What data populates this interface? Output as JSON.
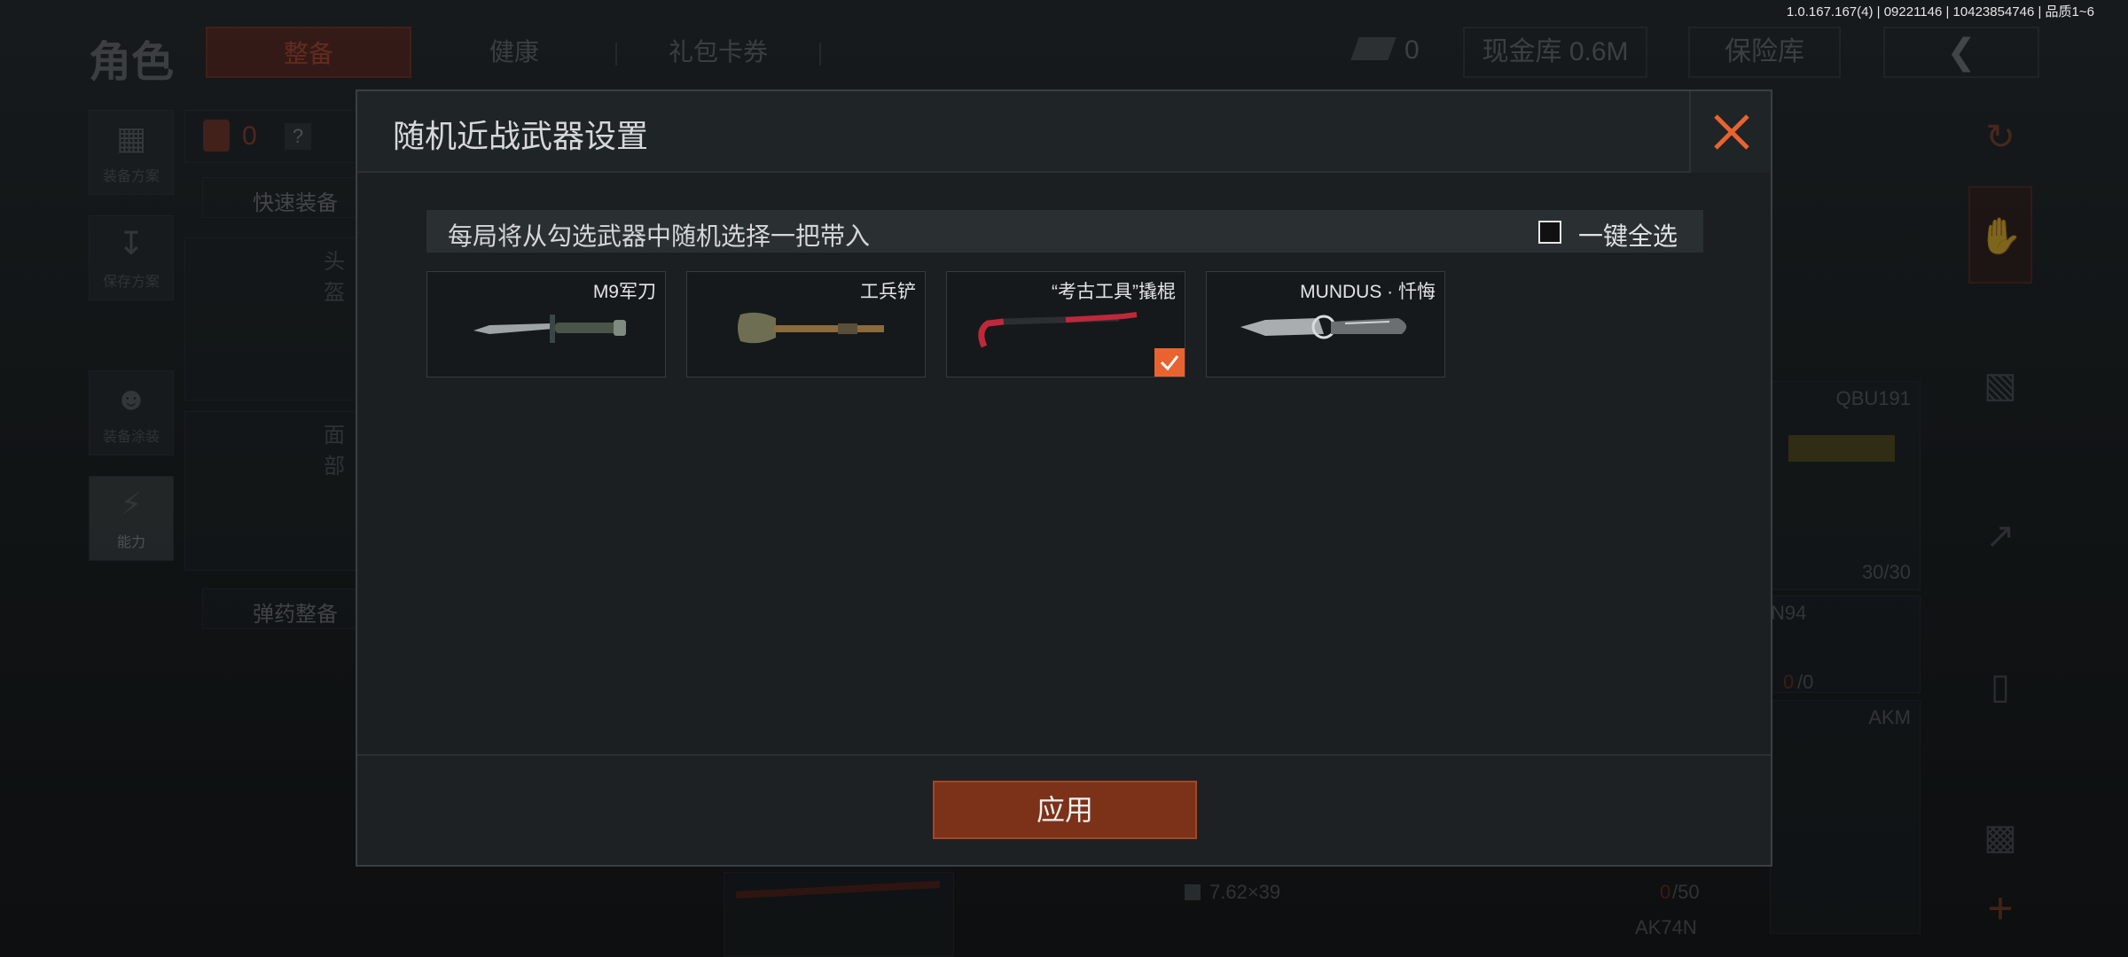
{
  "version": "1.0.167.167(4) | 09221146 | 10423854746 | 品质1~6",
  "topbar": {
    "title": "角色",
    "tabs": [
      "整备",
      "健康",
      "礼包卡券"
    ],
    "currency_value": "0",
    "cash_vault": "现金库 0.6M",
    "insurance_vault": "保险库"
  },
  "left_nav": [
    {
      "label": "装备方案",
      "icon": "vest-icon"
    },
    {
      "label": "保存方案",
      "icon": "download-icon"
    },
    {
      "label": "装备涂装",
      "icon": "soldier-icon"
    },
    {
      "label": "能力",
      "icon": "lightning-icon"
    }
  ],
  "background": {
    "armor_count": "0",
    "quick_equip": "快速装备",
    "head_slot": "头盔",
    "face_slot": "面部",
    "ammo_equip": "弹药整备",
    "weapon_qbu": "QBU191",
    "ammo_qbu": "30/30",
    "weapon_n94": "N94",
    "ammo_n94_cur": "0",
    "ammo_n94_max": "/0",
    "weapon_akm": "AKM",
    "caliber": "7.62×39",
    "ammo_akm_cur": "0",
    "ammo_akm_max": "/50",
    "weapon_ak74n": "AK74N"
  },
  "modal": {
    "title": "随机近战武器设置",
    "info": "每局将从勾选武器中随机选择一把带入",
    "select_all_label": "一键全选",
    "select_all_checked": false,
    "weapons": [
      {
        "name": "M9军刀",
        "icon": "combat-knife-icon",
        "checked": false
      },
      {
        "name": "工兵铲",
        "icon": "shovel-icon",
        "checked": false
      },
      {
        "name": "“考古工具”撬棍",
        "icon": "crowbar-icon",
        "checked": true
      },
      {
        "name": "MUNDUS · 忏悔",
        "icon": "ornate-knife-icon",
        "checked": false
      }
    ],
    "apply_label": "应用"
  },
  "colors": {
    "accent": "#e8632f",
    "apply_bg": "#7b3218",
    "modal_bg": "#1b1f22"
  }
}
